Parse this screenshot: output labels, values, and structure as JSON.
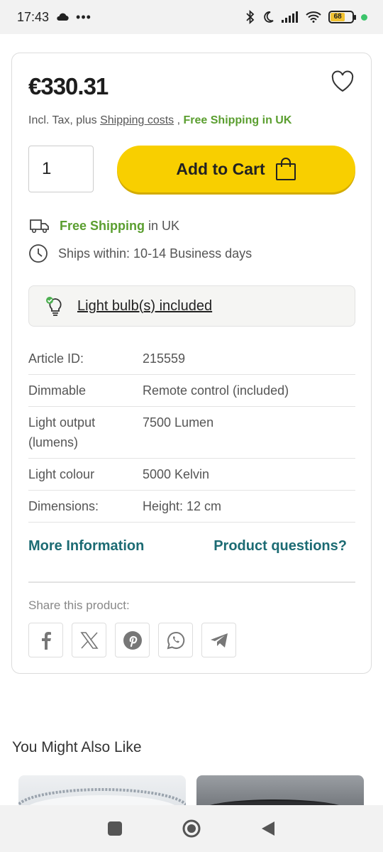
{
  "status": {
    "time": "17:43",
    "battery": "68"
  },
  "product": {
    "price": "€330.31",
    "tax_prefix": "Incl. Tax, plus ",
    "shipping_costs_link": "Shipping costs",
    "tax_separator": " , ",
    "free_shipping_uk": "Free Shipping in UK",
    "quantity": "1",
    "add_to_cart": "Add to Cart"
  },
  "shipping": {
    "free_label": "Free Shipping",
    "free_suffix": " in UK",
    "ships_within": "Ships within: 10-14 Business days"
  },
  "bulb_notice": "Light bulb(s) included",
  "specs": [
    {
      "key": "Article ID:",
      "value": "215559"
    },
    {
      "key": "Dimmable",
      "value": "Remote control (included)"
    },
    {
      "key": "Light output (lumens)",
      "value": "7500 Lumen"
    },
    {
      "key": "Light colour",
      "value": "5000 Kelvin"
    },
    {
      "key": "Dimensions:",
      "value": "Height: 12 cm"
    }
  ],
  "links": {
    "more_information": "More Information",
    "product_questions": "Product questions?"
  },
  "share": {
    "label": "Share this product:",
    "networks": [
      "facebook-icon",
      "x-icon",
      "pinterest-icon",
      "whatsapp-icon",
      "telegram-icon"
    ]
  },
  "recommendations": {
    "title": "You Might Also Like"
  },
  "colors": {
    "accent_green": "#5a9e2f",
    "cta_yellow": "#f8cf00",
    "link_teal": "#1c6b73"
  }
}
